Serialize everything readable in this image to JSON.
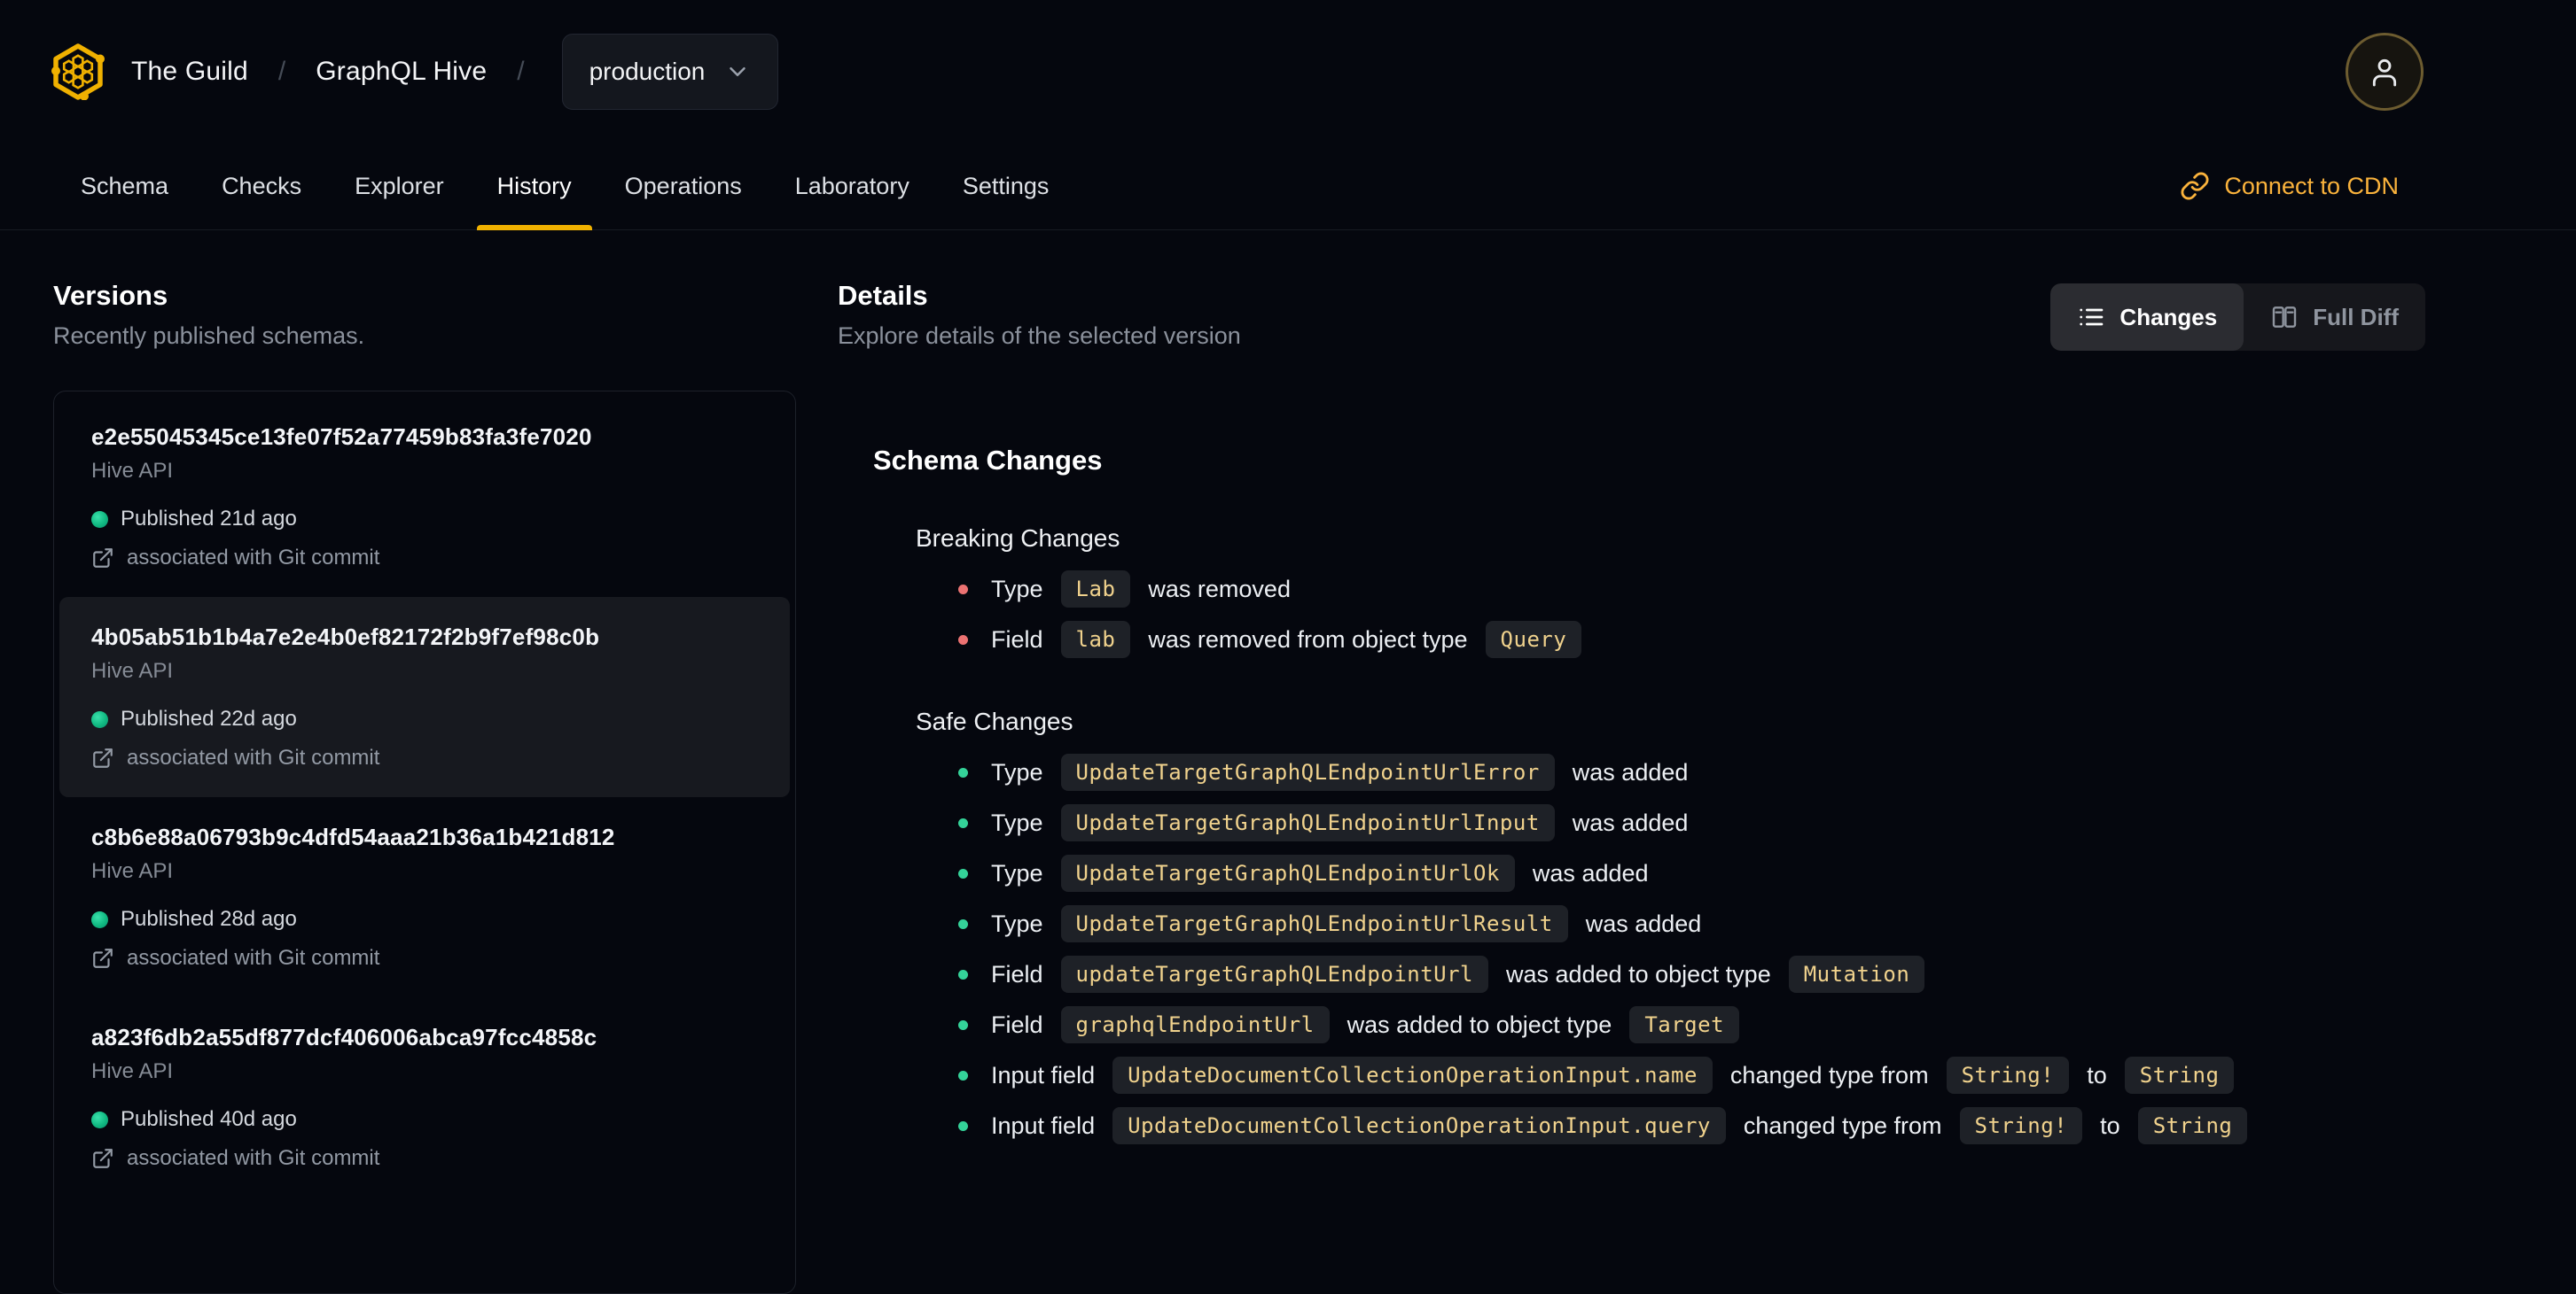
{
  "colors": {
    "accent": "#f0b100",
    "link": "#fbb33c",
    "breaking_bullet": "#ec7272",
    "safe_bullet": "#34d399",
    "published_dot": "#10b981",
    "chip_text": "#f0d28d",
    "chip_bg": "#1e2127"
  },
  "header": {
    "org": "The Guild",
    "separator": "/",
    "project": "GraphQL Hive",
    "target_selector": {
      "value": "production"
    }
  },
  "tabs": [
    {
      "label": "Schema",
      "active": false
    },
    {
      "label": "Checks",
      "active": false
    },
    {
      "label": "Explorer",
      "active": false
    },
    {
      "label": "History",
      "active": true
    },
    {
      "label": "Operations",
      "active": false
    },
    {
      "label": "Laboratory",
      "active": false
    },
    {
      "label": "Settings",
      "active": false
    }
  ],
  "cdn_link": {
    "label": "Connect to CDN"
  },
  "versions": {
    "title": "Versions",
    "subtitle": "Recently published schemas.",
    "items": [
      {
        "hash": "e2e55045345ce13fe07f52a77459b83fa3fe7020",
        "service": "Hive API",
        "published": "Published 21d ago",
        "git": "associated with Git commit",
        "selected": false
      },
      {
        "hash": "4b05ab51b1b4a7e2e4b0ef82172f2b9f7ef98c0b",
        "service": "Hive API",
        "published": "Published 22d ago",
        "git": "associated with Git commit",
        "selected": true
      },
      {
        "hash": "c8b6e88a06793b9c4dfd54aaa21b36a1b421d812",
        "service": "Hive API",
        "published": "Published 28d ago",
        "git": "associated with Git commit",
        "selected": false
      },
      {
        "hash": "a823f6db2a55df877dcf406006abca97fcc4858c",
        "service": "Hive API",
        "published": "Published 40d ago",
        "git": "associated with Git commit",
        "selected": false
      }
    ]
  },
  "details": {
    "title": "Details",
    "subtitle": "Explore details of the selected version",
    "view_toggle": {
      "changes_label": "Changes",
      "full_diff_label": "Full Diff",
      "active": "Changes"
    },
    "schema_changes": {
      "title": "Schema Changes",
      "breaking": {
        "title": "Breaking Changes",
        "items": [
          {
            "parts": [
              {
                "kind": "text",
                "value": "Type"
              },
              {
                "kind": "code",
                "value": "Lab"
              },
              {
                "kind": "text",
                "value": "was removed"
              }
            ]
          },
          {
            "parts": [
              {
                "kind": "text",
                "value": "Field"
              },
              {
                "kind": "code",
                "value": "lab"
              },
              {
                "kind": "text",
                "value": "was removed from object type"
              },
              {
                "kind": "code",
                "value": "Query"
              }
            ]
          }
        ]
      },
      "safe": {
        "title": "Safe Changes",
        "items": [
          {
            "parts": [
              {
                "kind": "text",
                "value": "Type"
              },
              {
                "kind": "code",
                "value": "UpdateTargetGraphQLEndpointUrlError"
              },
              {
                "kind": "text",
                "value": "was added"
              }
            ]
          },
          {
            "parts": [
              {
                "kind": "text",
                "value": "Type"
              },
              {
                "kind": "code",
                "value": "UpdateTargetGraphQLEndpointUrlInput"
              },
              {
                "kind": "text",
                "value": "was added"
              }
            ]
          },
          {
            "parts": [
              {
                "kind": "text",
                "value": "Type"
              },
              {
                "kind": "code",
                "value": "UpdateTargetGraphQLEndpointUrlOk"
              },
              {
                "kind": "text",
                "value": "was added"
              }
            ]
          },
          {
            "parts": [
              {
                "kind": "text",
                "value": "Type"
              },
              {
                "kind": "code",
                "value": "UpdateTargetGraphQLEndpointUrlResult"
              },
              {
                "kind": "text",
                "value": "was added"
              }
            ]
          },
          {
            "parts": [
              {
                "kind": "text",
                "value": "Field"
              },
              {
                "kind": "code",
                "value": "updateTargetGraphQLEndpointUrl"
              },
              {
                "kind": "text",
                "value": "was added to object type"
              },
              {
                "kind": "code",
                "value": "Mutation"
              }
            ]
          },
          {
            "parts": [
              {
                "kind": "text",
                "value": "Field"
              },
              {
                "kind": "code",
                "value": "graphqlEndpointUrl"
              },
              {
                "kind": "text",
                "value": "was added to object type"
              },
              {
                "kind": "code",
                "value": "Target"
              }
            ]
          },
          {
            "parts": [
              {
                "kind": "text",
                "value": "Input field"
              },
              {
                "kind": "code",
                "value": "UpdateDocumentCollectionOperationInput.name"
              },
              {
                "kind": "text",
                "value": "changed type from"
              },
              {
                "kind": "code",
                "value": "String!"
              },
              {
                "kind": "text",
                "value": "to"
              },
              {
                "kind": "code",
                "value": "String"
              }
            ]
          },
          {
            "parts": [
              {
                "kind": "text",
                "value": "Input field"
              },
              {
                "kind": "code",
                "value": "UpdateDocumentCollectionOperationInput.query"
              },
              {
                "kind": "text",
                "value": "changed type from"
              },
              {
                "kind": "code",
                "value": "String!"
              },
              {
                "kind": "text",
                "value": "to"
              },
              {
                "kind": "code",
                "value": "String"
              }
            ]
          }
        ]
      }
    }
  }
}
